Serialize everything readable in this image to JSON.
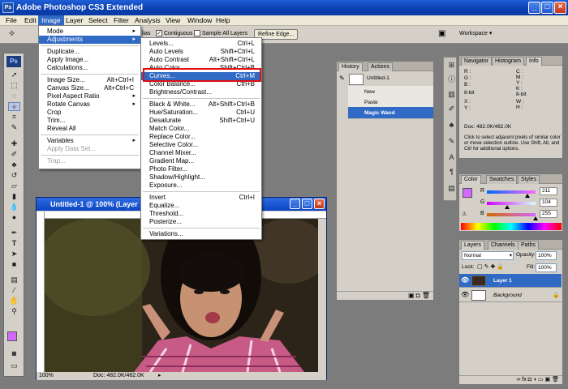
{
  "window": {
    "title": "Adobe Photoshop CS3 Extended",
    "logo": "Ps"
  },
  "menubar": [
    "File",
    "Edit",
    "Image",
    "Layer",
    "Select",
    "Filter",
    "Analysis",
    "View",
    "Window",
    "Help"
  ],
  "options": {
    "tail_label": "lias",
    "contiguous": "Contiguous",
    "sample_all": "Sample All Layers",
    "refine_edge": "Refine Edge...",
    "workspace": "Workspace ▾"
  },
  "image_menu": {
    "items": [
      {
        "label": "Mode",
        "arrow": "▸"
      },
      {
        "label": "Adjustments",
        "arrow": "▸",
        "highlight": true
      },
      {
        "sep": true
      },
      {
        "label": "Duplicate..."
      },
      {
        "label": "Apply Image..."
      },
      {
        "label": "Calculations..."
      },
      {
        "sep": true
      },
      {
        "label": "Image Size...",
        "shortcut": "Alt+Ctrl+I"
      },
      {
        "label": "Canvas Size...",
        "shortcut": "Alt+Ctrl+C"
      },
      {
        "label": "Pixel Aspect Ratio",
        "arrow": "▸"
      },
      {
        "label": "Rotate Canvas",
        "arrow": "▸"
      },
      {
        "label": "Crop"
      },
      {
        "label": "Trim..."
      },
      {
        "label": "Reveal All"
      },
      {
        "sep": true
      },
      {
        "label": "Variables",
        "arrow": "▸"
      },
      {
        "label": "Apply Data Set...",
        "disabled": true
      },
      {
        "sep": true
      },
      {
        "label": "Trap...",
        "disabled": true
      }
    ]
  },
  "adjust_menu": {
    "items": [
      {
        "label": "Levels...",
        "shortcut": "Ctrl+L"
      },
      {
        "label": "Auto Levels",
        "shortcut": "Shift+Ctrl+L"
      },
      {
        "label": "Auto Contrast",
        "shortcut": "Alt+Shift+Ctrl+L"
      },
      {
        "label": "Auto Color",
        "shortcut": "Shift+Ctrl+B"
      },
      {
        "label": "Curves...",
        "shortcut": "Ctrl+M",
        "highlight": true
      },
      {
        "label": "Color Balance...",
        "shortcut": "Ctrl+B"
      },
      {
        "label": "Brightness/Contrast..."
      },
      {
        "sep": true
      },
      {
        "label": "Black & White...",
        "shortcut": "Alt+Shift+Ctrl+B"
      },
      {
        "label": "Hue/Saturation...",
        "shortcut": "Ctrl+U"
      },
      {
        "label": "Desaturate",
        "shortcut": "Shift+Ctrl+U"
      },
      {
        "label": "Match Color..."
      },
      {
        "label": "Replace Color..."
      },
      {
        "label": "Selective Color..."
      },
      {
        "label": "Channel Mixer..."
      },
      {
        "label": "Gradient Map..."
      },
      {
        "label": "Photo Filter..."
      },
      {
        "label": "Shadow/Highlight..."
      },
      {
        "label": "Exposure..."
      },
      {
        "sep": true
      },
      {
        "label": "Invert",
        "shortcut": "Ctrl+I"
      },
      {
        "label": "Equalize..."
      },
      {
        "label": "Threshold..."
      },
      {
        "label": "Posterize..."
      },
      {
        "sep": true
      },
      {
        "label": "Variations..."
      }
    ]
  },
  "history": {
    "tabs": [
      "History",
      "Actions"
    ],
    "snapshot": "Untitled-1",
    "steps": [
      "New",
      "Paste",
      "Magic Wand"
    ]
  },
  "navigator": {
    "tabs": [
      "Navigator",
      "Histogram",
      "Info"
    ],
    "rgb": [
      "R :",
      "G :",
      "B :"
    ],
    "cmyk": [
      "C :",
      "M :",
      "Y :",
      "K :"
    ],
    "bits1": "8-bit",
    "bits2": "8-bit",
    "xy": [
      "X :",
      "Y :"
    ],
    "wh": [
      "W :",
      "H :"
    ],
    "doc": "Doc: 482.0K/482.0K",
    "help": "Click to select adjacent pixels of similar color or move selection outline.  Use Shift, Alt, and Ctrl for additional options."
  },
  "color": {
    "tabs": [
      "Color",
      "Swatches",
      "Styles"
    ],
    "r_label": "R",
    "g_label": "G",
    "b_label": "B",
    "r": "211",
    "g": "104",
    "b": "255",
    "r_fill": 0.83,
    "g_fill": 0.41,
    "b_fill": 1.0,
    "swatch": "#d368ff"
  },
  "layers": {
    "tabs": [
      "Layers",
      "Channels",
      "Paths"
    ],
    "mode": "Normal",
    "opacity_label": "Opacity:",
    "opacity": "100%",
    "lock_label": "Lock:",
    "fill_label": "Fill:",
    "fill": "100%",
    "rows": [
      "Layer 1",
      "Background"
    ]
  },
  "document": {
    "title": "Untitled-1 @ 100% (Layer 1, RGB/8)",
    "zoom": "100%",
    "status": "Doc: 482.0K/482.0K"
  },
  "colors": {
    "highlight": "#316ac5",
    "callout": "#e01010"
  }
}
